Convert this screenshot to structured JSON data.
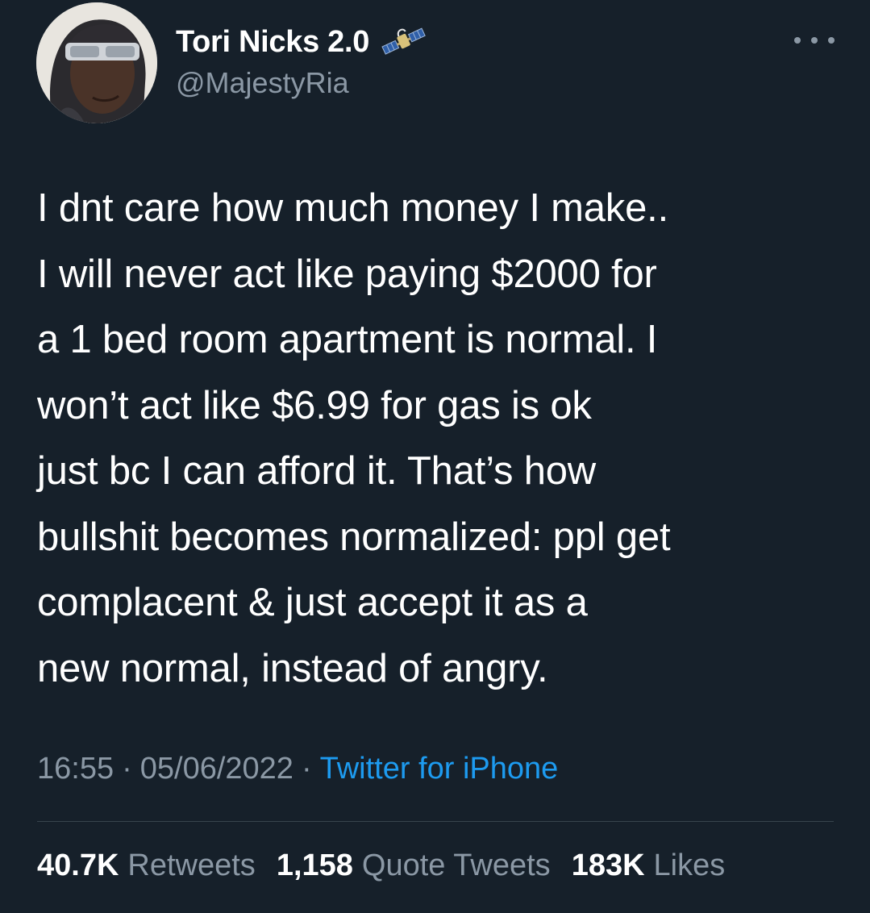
{
  "author": {
    "display_name": "Tori Nicks 2.0",
    "name_emoji": "satellite-icon",
    "handle": "@MajestyRia"
  },
  "tweet": {
    "lines": [
      "I dnt care how much money I make..",
      "I will never act like paying $2000 for",
      "a 1 bed room apartment is normal. I",
      "won’t act like $6.99 for gas is ok",
      "just bc I can afford it. That’s how",
      "bullshit becomes normalized: ppl get",
      "complacent & just accept it as a",
      "new normal, instead of angry."
    ],
    "time": "16:55",
    "separator": "·",
    "date": "05/06/2022",
    "source": "Twitter for iPhone"
  },
  "stats": [
    {
      "count": "40.7K",
      "label": "Retweets"
    },
    {
      "count": "1,158",
      "label": "Quote Tweets"
    },
    {
      "count": "183K",
      "label": "Likes"
    }
  ],
  "colors": {
    "background": "#16202a",
    "text": "#ffffff",
    "secondary_text": "#8b98a5",
    "link": "#1d9bf0",
    "divider": "#38444d"
  }
}
